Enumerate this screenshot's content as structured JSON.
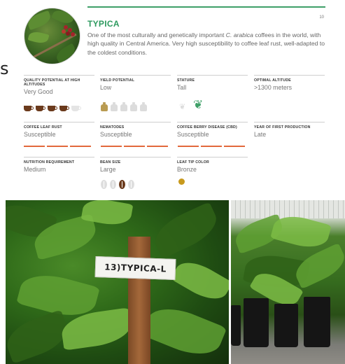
{
  "stray_char": "s",
  "page_number": "10",
  "variety": {
    "title": "TYPICA",
    "description_pre": "One of the most culturally and genetically important ",
    "description_species": "C. arabica",
    "description_post": " coffees in the world, with high quality in Central America. Very high susceptibility to coffee leaf rust, well-adapted to the coldest conditions."
  },
  "attributes": [
    {
      "label": "QUALITY POTENTIAL AT HIGH ALTITUDES",
      "value": "Very Good"
    },
    {
      "label": "YIELD POTENTIAL",
      "value": "Low"
    },
    {
      "label": "STATURE",
      "value": "Tall"
    },
    {
      "label": "OPTIMAL ALTITUDE",
      "value": ">1300 meters"
    },
    {
      "label": "COFFEE LEAF RUST",
      "value": "Susceptible"
    },
    {
      "label": "NEMATODES",
      "value": "Susceptible"
    },
    {
      "label": "COFFEE BERRY DISEASE (CBD)",
      "value": "Susceptible"
    },
    {
      "label": "YEAR OF FIRST PRODUCTION",
      "value": "Late"
    },
    {
      "label": "NUTRITION REQUIREMENT",
      "value": "Medium"
    },
    {
      "label": "BEAN SIZE",
      "value": "Large"
    },
    {
      "label": "LEAF TIP COLOR",
      "value": "Bronze"
    }
  ],
  "ratings": {
    "quality_cups_filled": 4,
    "quality_cups_total": 5,
    "yield_sacks_filled": 1,
    "yield_sacks_total": 5,
    "stature_selected": "tall",
    "bean_size_selected_index": 2,
    "bean_size_total": 4
  },
  "colors": {
    "accent_green": "#2e9a5f",
    "coffee_brown": "#6b3a1c",
    "sack_gold": "#b99b52",
    "risk_orange": "#e2683c",
    "leaf_tip_bronze": "#c89a1d"
  },
  "photo_label": "13)TYPICA-L"
}
